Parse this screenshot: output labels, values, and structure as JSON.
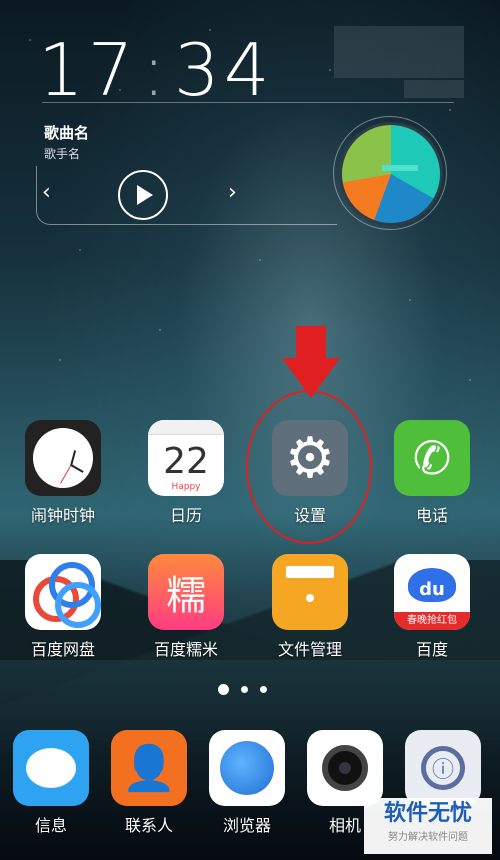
{
  "status": {
    "time_hour": "17",
    "time_colon": ":",
    "time_minute": "34"
  },
  "music": {
    "title": "歌曲名",
    "artist": "歌手名",
    "prev_glyph": "‹",
    "next_glyph": "›"
  },
  "apps_row1": [
    {
      "label": "闹钟时钟",
      "icon": "clock-icon"
    },
    {
      "label": "日历",
      "icon": "calendar-icon",
      "day": "22",
      "sub": "Happy"
    },
    {
      "label": "设置",
      "icon": "settings-icon",
      "glyph": "⚙"
    },
    {
      "label": "电话",
      "icon": "phone-icon",
      "glyph": "✆"
    }
  ],
  "apps_row2": [
    {
      "label": "百度网盘",
      "icon": "cloud-disk-icon"
    },
    {
      "label": "百度糯米",
      "icon": "nuomi-icon",
      "glyph": "糯"
    },
    {
      "label": "文件管理",
      "icon": "folder-icon"
    },
    {
      "label": "百度",
      "icon": "baidu-icon",
      "glyph": "du",
      "banner": "春晚抢红包"
    }
  ],
  "dock": [
    {
      "label": "信息",
      "icon": "message-icon"
    },
    {
      "label": "联系人",
      "icon": "contacts-icon",
      "glyph": "👤"
    },
    {
      "label": "浏览器",
      "icon": "browser-icon"
    },
    {
      "label": "相机",
      "icon": "camera-icon"
    },
    {
      "label": "",
      "icon": "vault-icon",
      "glyph": "ⓘ"
    }
  ],
  "page_indicator": {
    "pages": 3,
    "current": 1
  },
  "watermark": {
    "title": "软件无忧",
    "subtitle": "努力解决软件问题"
  },
  "colors": {
    "annotation": "#e02020",
    "settings_bg": "#5f6f7c",
    "phone_bg": "#4fbf3b"
  }
}
